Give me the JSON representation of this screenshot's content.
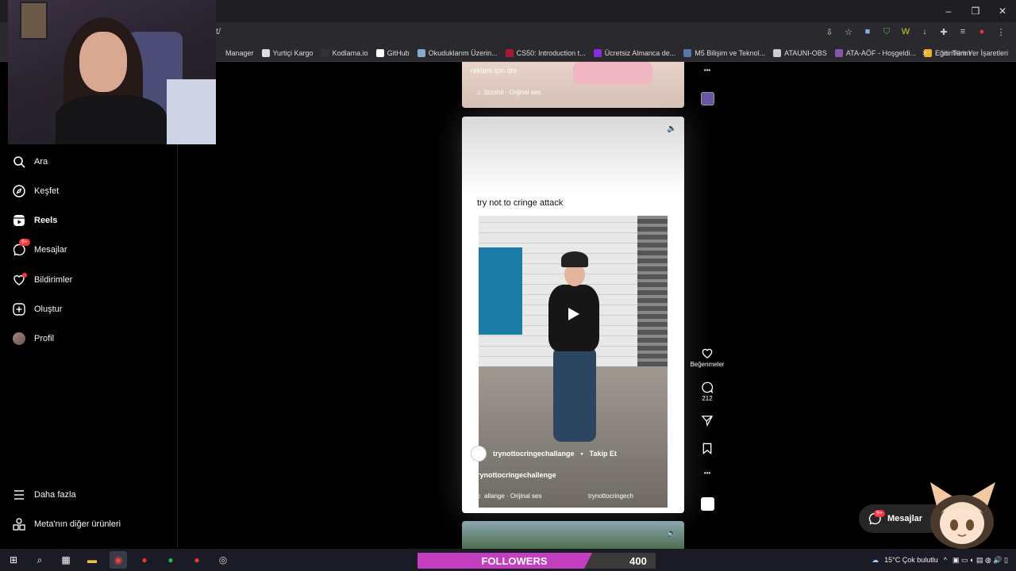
{
  "browser": {
    "url_fragment": "t/",
    "bookmarks": [
      {
        "label": "Manager",
        "color": "#2a2a2e"
      },
      {
        "label": "Yurtiçi Kargo",
        "color": "#dddddd"
      },
      {
        "label": "Kodlama.io",
        "color": "#333333"
      },
      {
        "label": "GitHub",
        "color": "#ffffff"
      },
      {
        "label": "Okuduklarım Üzerin...",
        "color": "#88aacc"
      },
      {
        "label": "CS50: Introduction t...",
        "color": "#a51c30"
      },
      {
        "label": "Ücretsiz Almanca de...",
        "color": "#8a2be2"
      },
      {
        "label": "M5 Bilişim ve Teknol...",
        "color": "#5577aa"
      },
      {
        "label": "ATAUNI-OBS",
        "color": "#cccccc"
      },
      {
        "label": "ATA-AÖF - Hoşgeldi...",
        "color": "#8855aa"
      },
      {
        "label": "Eğitimlerim",
        "color": "#f0b429"
      }
    ],
    "more_bookmarks": "»",
    "all_bookmarks": "Tüm Yer İşaretleri"
  },
  "sidebar": {
    "items": [
      {
        "label": "Ara",
        "icon": "search-icon"
      },
      {
        "label": "Keşfet",
        "icon": "compass-icon"
      },
      {
        "label": "Reels",
        "icon": "reels-icon"
      },
      {
        "label": "Mesajlar",
        "icon": "messenger-icon",
        "badge": "9+"
      },
      {
        "label": "Bildirimler",
        "icon": "heart-icon"
      },
      {
        "label": "Oluştur",
        "icon": "plus-square-icon"
      },
      {
        "label": "Profil",
        "icon": "avatar"
      }
    ],
    "more": "Daha fazla",
    "meta": "Meta'nın diğer ürünleri"
  },
  "feed": {
    "prev": {
      "caption": "reklam için dm",
      "audio": "tizzshit · Orijinal ses"
    },
    "current": {
      "title": "try not to cringe attack",
      "account": "trynottocringechallange",
      "separator": "•",
      "follow": "Takip Et",
      "hashtag": "#trynottocringechallenge",
      "audio": "allange · Orijinal ses",
      "audio_right": "trynottocringech",
      "likes_label": "Beğenmeler",
      "comments": "212"
    }
  },
  "messages": {
    "label": "Mesajlar",
    "badge": "9+"
  },
  "taskbar": {
    "followers_label": "FOLLOWERS",
    "followers_count": "400",
    "weather": "15°C  Çok bulutlu",
    "colors": {
      "followers_bar": "#c43fc0",
      "followers_bg": "#3a3a3a"
    }
  }
}
